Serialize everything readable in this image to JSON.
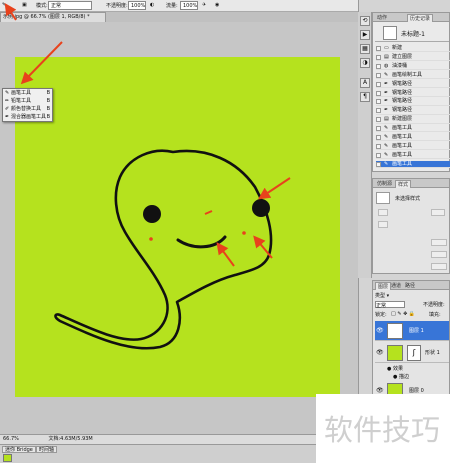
{
  "options_bar": {
    "mode_label": "模式:",
    "mode_value": "正常",
    "opacity_label": "不透明度:",
    "opacity_value": "100%",
    "flow_label": "流量:",
    "flow_value": "100%"
  },
  "document_tab": {
    "title": "示例.jpg @ 66.7% (图层 1, RGB/8) *"
  },
  "tool_flyout": {
    "items": [
      {
        "label": "画笔工具",
        "key": "B"
      },
      {
        "label": "铅笔工具",
        "key": "B"
      },
      {
        "label": "颜色替换工具",
        "key": "B"
      },
      {
        "label": "混合器画笔工具",
        "key": "B"
      }
    ]
  },
  "history_panel": {
    "tabs": [
      "历史记录",
      "动作"
    ],
    "snapshot_label": "未标题-1",
    "items": [
      {
        "label": "新建",
        "icon": "new-doc-icon"
      },
      {
        "label": "建立图层",
        "icon": "layer-icon"
      },
      {
        "label": "油漆桶",
        "icon": "bucket-icon"
      },
      {
        "label": "画笔绘制工具",
        "icon": "brush-icon"
      },
      {
        "label": "钢笔路径",
        "icon": "pen-icon"
      },
      {
        "label": "钢笔路径",
        "icon": "pen-icon"
      },
      {
        "label": "钢笔路径",
        "icon": "pen-icon"
      },
      {
        "label": "钢笔路径",
        "icon": "pen-icon"
      },
      {
        "label": "新建图层",
        "icon": "layer-icon"
      },
      {
        "label": "画笔工具",
        "icon": "brush-icon"
      },
      {
        "label": "画笔工具",
        "icon": "brush-icon"
      },
      {
        "label": "画笔工具",
        "icon": "brush-icon"
      },
      {
        "label": "画笔工具",
        "icon": "brush-icon"
      },
      {
        "label": "画笔工具",
        "icon": "brush-icon",
        "selected": true
      }
    ]
  },
  "style_panel": {
    "tabs": [
      "仿制源",
      "样式"
    ],
    "label": "未选择样式"
  },
  "layers_panel": {
    "tabs": [
      "图层",
      "通道",
      "路径"
    ],
    "kind_label": "类型",
    "blend_mode": "正常",
    "opacity_label": "不透明度:",
    "lock_label": "锁定:",
    "fill_label": "填充:",
    "layers": [
      {
        "name": "图层 1",
        "selected": true,
        "thumb": "#ffffff"
      },
      {
        "name": "形状 1",
        "selected": false,
        "thumb": "#b5e21e"
      },
      {
        "name": "图层 0",
        "selected": false,
        "thumb": "#b5e21e"
      }
    ],
    "effects_label": "效果",
    "effect_item": "描边"
  },
  "status_bar": {
    "zoom": "66.7%",
    "doc_info": "文档:4.63M/5.93M"
  },
  "bottom_tabs": [
    "迷你 Bridge",
    "时间轴"
  ],
  "watermark": {
    "text": "软件技巧"
  },
  "colors": {
    "canvas": "#b5e21e",
    "arrow": "#e8421c",
    "selection": "#3875d7"
  }
}
